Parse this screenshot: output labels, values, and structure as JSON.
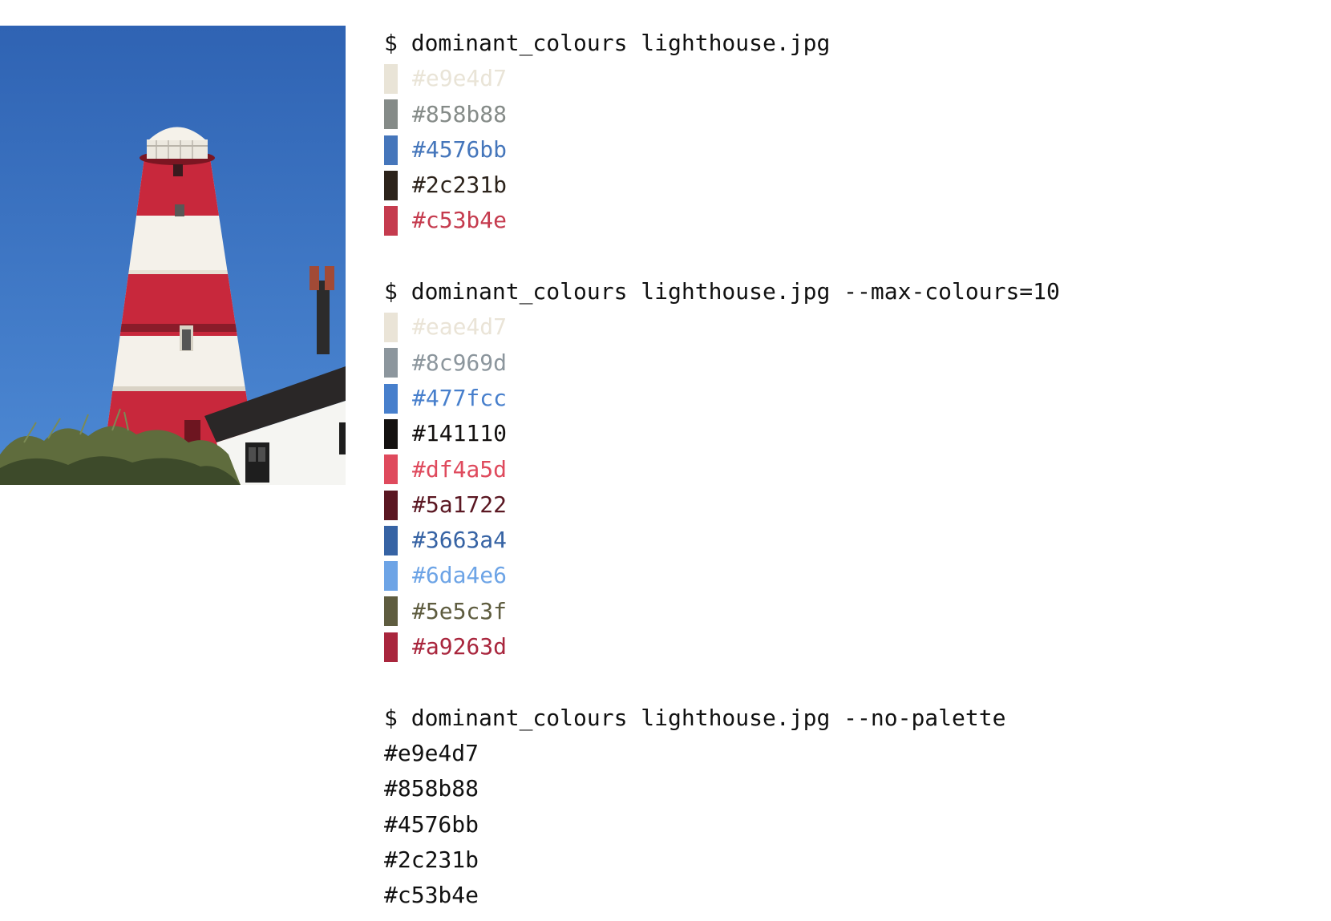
{
  "image": {
    "name": "lighthouse photograph",
    "colors": {
      "sky_top": "#2f63b3",
      "sky_bottom": "#4a85d0",
      "red": "#c8283c",
      "white": "#f4f1ea",
      "lantern": "#ece8df",
      "roof": "#2a2727",
      "house": "#f5f5f2",
      "bush": "#5f6c3d",
      "bush_dark": "#3d4a2a",
      "chimney": "#a24a36"
    }
  },
  "blocks": [
    {
      "command": "$ dominant_colours lighthouse.jpg",
      "colors": [
        "#e9e4d7",
        "#858b88",
        "#4576bb",
        "#2c231b",
        "#c53b4e"
      ]
    },
    {
      "command": "$ dominant_colours lighthouse.jpg --max-colours=10",
      "colors": [
        "#eae4d7",
        "#8c969d",
        "#477fcc",
        "#141110",
        "#df4a5d",
        "#5a1722",
        "#3663a4",
        "#6da4e6",
        "#5e5c3f",
        "#a9263d"
      ]
    },
    {
      "command": "$ dominant_colours lighthouse.jpg --no-palette",
      "plain": [
        "#e9e4d7",
        "#858b88",
        "#4576bb",
        "#2c231b",
        "#c53b4e"
      ]
    }
  ]
}
